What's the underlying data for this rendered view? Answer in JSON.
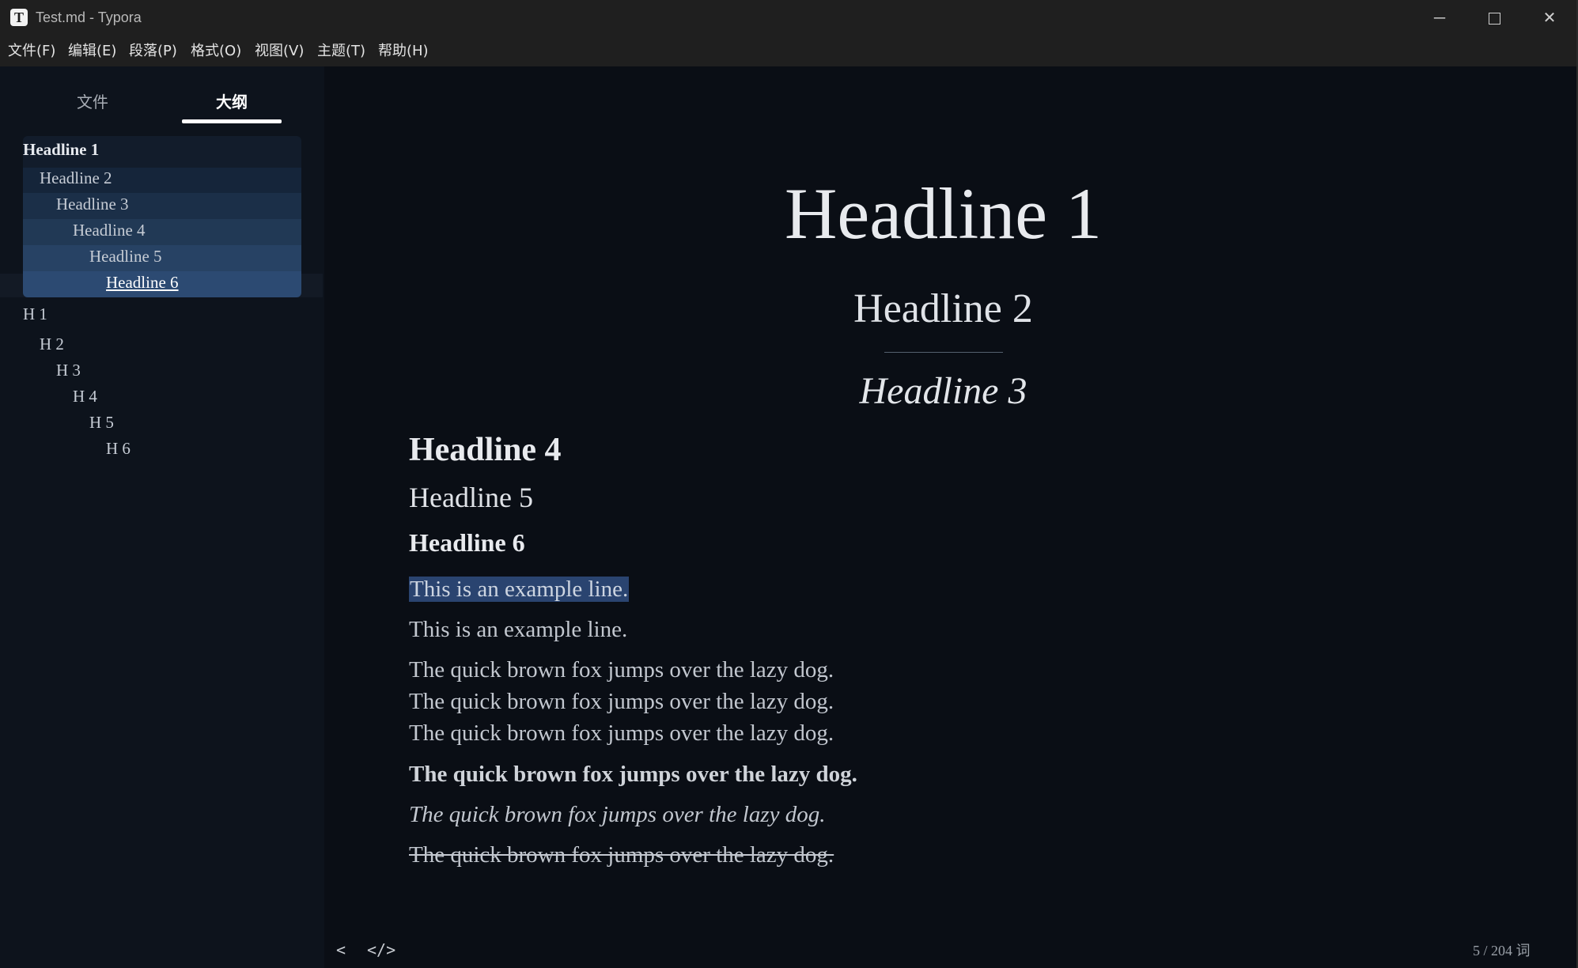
{
  "window": {
    "app_icon_letter": "T",
    "title": "Test.md - Typora",
    "minimize_glyph": "─",
    "close_glyph": "✕"
  },
  "menu": [
    "文件(F)",
    "编辑(E)",
    "段落(P)",
    "格式(O)",
    "视图(V)",
    "主题(T)",
    "帮助(H)"
  ],
  "sidebar": {
    "tab_files": "文件",
    "tab_outline": "大纲",
    "active_tab": "大纲",
    "outline_items": [
      {
        "label": "Headline 1",
        "level": 1
      },
      {
        "label": "Headline 2",
        "level": 2
      },
      {
        "label": "Headline 3",
        "level": 3
      },
      {
        "label": "Headline 4",
        "level": 4
      },
      {
        "label": "Headline 5",
        "level": 5
      },
      {
        "label": "Headline 6",
        "level": 6
      },
      {
        "label": "H 1",
        "level": 1
      },
      {
        "label": "H 2",
        "level": 2
      },
      {
        "label": "H 3",
        "level": 3
      },
      {
        "label": "H 4",
        "level": 4
      },
      {
        "label": "H 5",
        "level": 5
      },
      {
        "label": "H 6",
        "level": 6
      }
    ]
  },
  "document": {
    "h1": "Headline 1",
    "h2": "Headline 2",
    "h3": "Headline 3",
    "h4": "Headline 4",
    "h5": "Headline 5",
    "h6": "Headline 6",
    "line_selected": "This is an example line.",
    "line_plain": "This is an example line.",
    "fox_1": "The quick brown fox jumps over the lazy dog.",
    "fox_2": "The quick brown fox jumps over the lazy dog.",
    "fox_3": "The quick brown fox jumps over the lazy dog.",
    "fox_bold": "The quick brown fox jumps over the lazy dog.",
    "fox_italic": "The quick brown fox jumps over the lazy dog.",
    "fox_strike": "The quick brown fox jumps over the lazy dog."
  },
  "footer": {
    "back_glyph": "<",
    "source_glyph": "</>",
    "word_count": "5 / 204 词"
  },
  "colors": {
    "editor_bg": "#0a0e15",
    "sidebar_bg": "#0d131c",
    "selection": "#2a4470",
    "outline_highlight": "#2c4a72"
  }
}
